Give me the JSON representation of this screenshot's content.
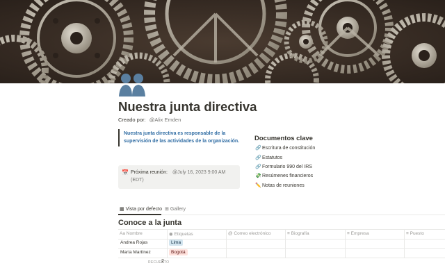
{
  "cover": {
    "image": "gears-cover",
    "colors": {
      "base": "#3a2e25",
      "metal": "#c8c2b4"
    }
  },
  "page": {
    "icon": "group-users-icon",
    "title": "Nuestra junta directiva",
    "created_label": "Creado por:",
    "created_by": "@Alix Emden"
  },
  "quote": {
    "text": "Nuestra junta directiva es responsable de la supervisión de las actividades de la organización."
  },
  "callout": {
    "icon": "calendar-icon",
    "label": "Próxima reunión:",
    "value": "@July 16, 2023 9:00 AM",
    "value_tz": "(EDT)"
  },
  "docs": {
    "heading": "Documentos clave",
    "items": [
      {
        "emoji": "🔗",
        "label": "Escritura de constitución"
      },
      {
        "emoji": "🔗",
        "label": "Estatutos"
      },
      {
        "emoji": "🔗",
        "label": "Formulario 990 del IRS"
      },
      {
        "emoji": "💸",
        "label": "Resúmenes financieros"
      },
      {
        "emoji": "✏️",
        "label": "Notas de reuniones"
      }
    ]
  },
  "tabs": [
    {
      "label": "Vista por defecto",
      "active": true
    },
    {
      "label": "Gallery",
      "active": false
    }
  ],
  "database": {
    "title": "Conoce a la junta",
    "columns": [
      {
        "icon": "Aa",
        "label": "Nombre"
      },
      {
        "icon": "◉",
        "label": "Etiquetas"
      },
      {
        "icon": "@",
        "label": "Correo electrónico"
      },
      {
        "icon": "≡",
        "label": "Biografía"
      },
      {
        "icon": "≡",
        "label": "Empresa"
      },
      {
        "icon": "≡",
        "label": "Puesto"
      }
    ],
    "rows": [
      {
        "name": "Andrea Rojas",
        "tag": "Lima",
        "tag_color": "#d3e5ef",
        "tag_text": "#183347"
      },
      {
        "name": "María Martínez",
        "tag": "Bogotá",
        "tag_color": "#ffe2dd",
        "tag_text": "#5d1715"
      }
    ],
    "count_label": "RECUENTO",
    "count_value": "2"
  }
}
